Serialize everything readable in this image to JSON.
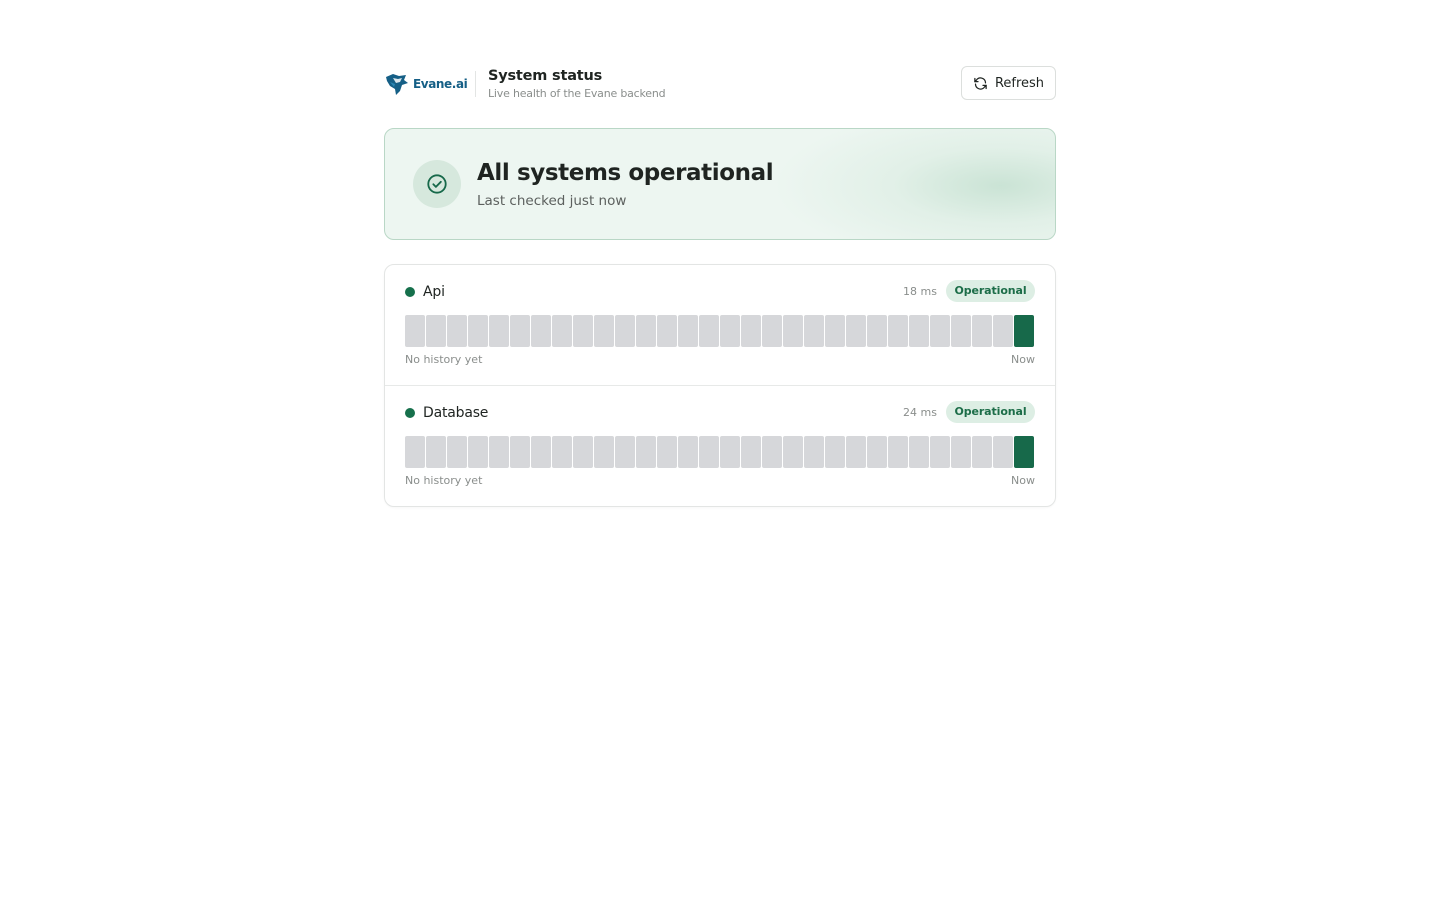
{
  "brand": {
    "name": "Evane.ai",
    "logo_icon": "eagle-logo-icon"
  },
  "header": {
    "title": "System status",
    "subtitle": "Live health of the Evane backend",
    "refresh_label": "Refresh",
    "refresh_icon": "refresh-icon"
  },
  "banner": {
    "title": "All systems operational",
    "subtitle": "Last checked just now",
    "icon": "check-circle-icon"
  },
  "services": [
    {
      "name": "Api",
      "latency": "18 ms",
      "status": "Operational",
      "history_start_label": "No history yet",
      "history_end_label": "Now",
      "history": [
        "none",
        "none",
        "none",
        "none",
        "none",
        "none",
        "none",
        "none",
        "none",
        "none",
        "none",
        "none",
        "none",
        "none",
        "none",
        "none",
        "none",
        "none",
        "none",
        "none",
        "none",
        "none",
        "none",
        "none",
        "none",
        "none",
        "none",
        "none",
        "none",
        "ok"
      ]
    },
    {
      "name": "Database",
      "latency": "24 ms",
      "status": "Operational",
      "history_start_label": "No history yet",
      "history_end_label": "Now",
      "history": [
        "none",
        "none",
        "none",
        "none",
        "none",
        "none",
        "none",
        "none",
        "none",
        "none",
        "none",
        "none",
        "none",
        "none",
        "none",
        "none",
        "none",
        "none",
        "none",
        "none",
        "none",
        "none",
        "none",
        "none",
        "none",
        "none",
        "none",
        "none",
        "none",
        "ok"
      ]
    }
  ],
  "colors": {
    "accent_green": "#17694a",
    "banner_bg": "#edf6f1",
    "badge_bg": "#ddeee4",
    "bar_empty": "#d6d7da",
    "brand_blue": "#155f86"
  }
}
